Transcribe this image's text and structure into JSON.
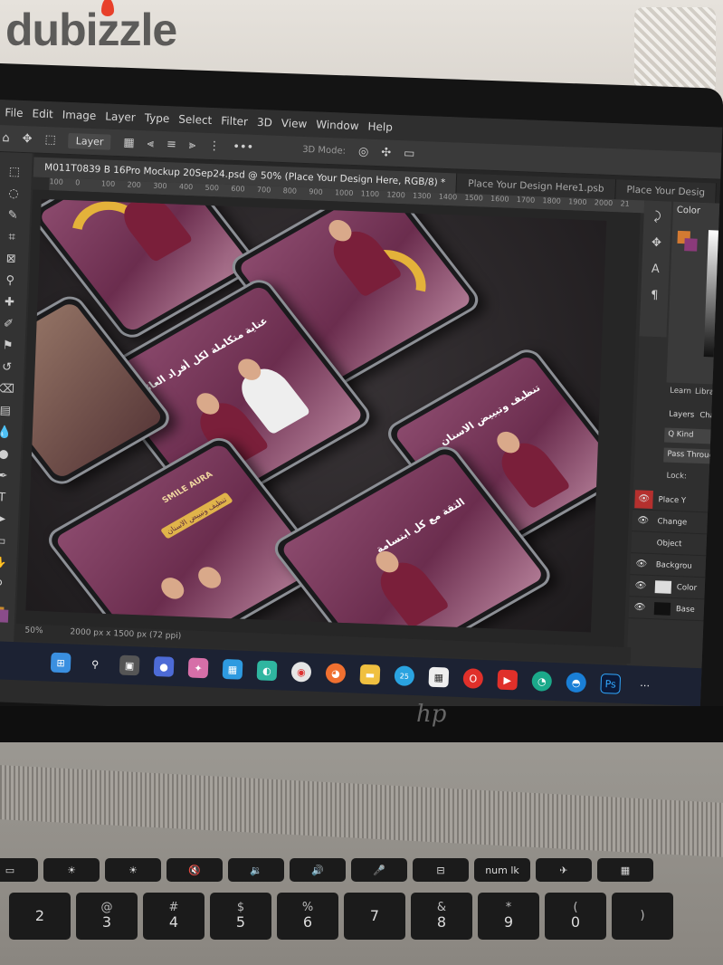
{
  "watermark": "dubizzle",
  "photoshop": {
    "menu": [
      "File",
      "Edit",
      "Image",
      "Layer",
      "Type",
      "Select",
      "Filter",
      "3D",
      "View",
      "Window",
      "Help"
    ],
    "options": {
      "layer_select": "Layer",
      "mode_label": "3D Mode:"
    },
    "tabs": [
      "M011T0839 B 16Pro Mockup 20Sep24.psd @ 50% (Place Your Design Here, RGB/8) *",
      "Place Your Design Here1.psb",
      "Place Your Desig"
    ],
    "ruler": [
      "100",
      "0",
      "100",
      "200",
      "300",
      "400",
      "500",
      "600",
      "700",
      "800",
      "900",
      "1000",
      "1100",
      "1200",
      "1300",
      "1400",
      "1500",
      "1600",
      "1700",
      "1800",
      "1900",
      "2000",
      "21"
    ],
    "status": {
      "zoom": "50%",
      "dimensions": "2000 px x 1500 px (72 ppi)"
    },
    "panels": {
      "color_label": "Color",
      "tabs": [
        "Learn",
        "Libra"
      ],
      "layers_tabs": [
        "Layers",
        "Chann"
      ],
      "kind_filter": "Q Kind",
      "blend_mode": "Pass Through",
      "lock_label": "Lock:",
      "layers": [
        {
          "name": "Place Y",
          "visible": true,
          "selected": true,
          "type": "folder"
        },
        {
          "name": "Change",
          "visible": true,
          "selected": false,
          "type": "folder"
        },
        {
          "name": "Object",
          "visible": false,
          "selected": false,
          "type": "folder"
        },
        {
          "name": "Backgrou",
          "visible": true,
          "selected": false,
          "type": "folder"
        },
        {
          "name": "Color",
          "visible": true,
          "selected": false,
          "type": "layer",
          "thumb": "light"
        },
        {
          "name": "Base",
          "visible": true,
          "selected": false,
          "type": "layer",
          "thumb": "dark"
        }
      ]
    },
    "canvas_mockups": {
      "brand": "SMILE AURA",
      "headline_1": "تنظيف وتبييض الاسنان",
      "headline_2": "الثقة مع كل ابتسامة",
      "headline_3": "عناية متكاملة لكل أفراد العائلة"
    }
  },
  "taskbar": {
    "icons": [
      "windows-start",
      "search",
      "task-view",
      "chat",
      "copilot",
      "store",
      "widgets",
      "chrome",
      "firefox",
      "explorer",
      "telegram",
      "calendar",
      "opera",
      "youtube",
      "edge-dev",
      "edge",
      "photoshop",
      "more"
    ],
    "badge": "25"
  },
  "keyboard": {
    "fn_row": [
      "▭",
      "☀",
      "☀",
      "🔇",
      "🔉",
      "🔊",
      "🎤",
      "⊟",
      "num lk",
      "✈",
      "▦"
    ],
    "num_row": [
      {
        "top": "",
        "main": "2"
      },
      {
        "top": "@",
        "main": "3"
      },
      {
        "top": "#",
        "main": "4"
      },
      {
        "top": "$",
        "main": "5"
      },
      {
        "top": "%",
        "main": "6"
      },
      {
        "top": "",
        "main": "7"
      },
      {
        "top": "&",
        "main": "8"
      },
      {
        "top": "*",
        "main": "9"
      },
      {
        "top": "(",
        "main": "0"
      },
      {
        "top": ")",
        "main": ""
      }
    ]
  },
  "colors": {
    "ps_bg": "#2b2b2b",
    "mockup_maroon": "#6b2d4e",
    "mockup_gold": "#e4b23a",
    "layer_selected": "#b5302e",
    "taskbar": "#1c2233"
  }
}
